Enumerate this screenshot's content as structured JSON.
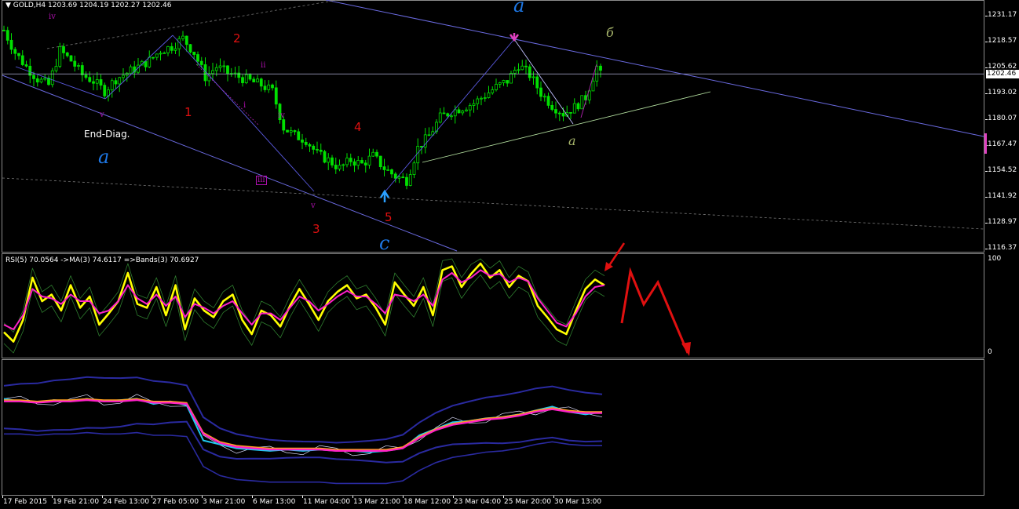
{
  "chart_data": [
    {
      "type": "candlestick",
      "title": "GOLD,H4 1203.69 1204.19 1202.27 1202.46",
      "symbol": "GOLD,H4",
      "ohlc": {
        "open": "1203.69",
        "high": "1204.19",
        "low": "1202.27",
        "close": "1202.46"
      },
      "last_price": "1202.46",
      "ylim": [
        1110,
        1240
      ],
      "yticks": [
        "1231.17",
        "1218.57",
        "1205.62",
        "1193.02",
        "1180.07",
        "1167.47",
        "1154.52",
        "1141.92",
        "1128.97",
        "1116.37"
      ],
      "xticks": [
        "17 Feb 2015",
        "19 Feb 21:00",
        "24 Feb 13:00",
        "27 Feb 05:00",
        "3 Mar 21:00",
        "6 Mar 13:00",
        "11 Mar 04:00",
        "13 Mar 21:00",
        "18 Mar 12:00",
        "23 Mar 04:00",
        "25 Mar 20:00",
        "30 Mar 13:00"
      ],
      "close_path": [
        [
          0,
          1224
        ],
        [
          3,
          1213
        ],
        [
          6,
          1206
        ],
        [
          9,
          1200
        ],
        [
          12,
          1197
        ],
        [
          15,
          1214
        ],
        [
          18,
          1209
        ],
        [
          21,
          1202
        ],
        [
          24,
          1199
        ],
        [
          27,
          1194
        ],
        [
          30,
          1200
        ],
        [
          33,
          1203
        ],
        [
          36,
          1206
        ],
        [
          39,
          1209
        ],
        [
          42,
          1214
        ],
        [
          45,
          1216
        ],
        [
          48,
          1220
        ],
        [
          51,
          1213
        ],
        [
          54,
          1201
        ],
        [
          57,
          1206
        ],
        [
          60,
          1203
        ],
        [
          63,
          1201
        ],
        [
          66,
          1199
        ],
        [
          69,
          1197
        ],
        [
          72,
          1194
        ],
        [
          75,
          1176
        ],
        [
          78,
          1172
        ],
        [
          81,
          1170
        ],
        [
          84,
          1163
        ],
        [
          87,
          1160
        ],
        [
          90,
          1156
        ],
        [
          93,
          1160
        ],
        [
          96,
          1158
        ],
        [
          99,
          1162
        ],
        [
          102,
          1156
        ],
        [
          105,
          1152
        ],
        [
          108,
          1150
        ],
        [
          111,
          1166
        ],
        [
          114,
          1172
        ],
        [
          117,
          1181
        ],
        [
          120,
          1184
        ],
        [
          123,
          1186
        ],
        [
          126,
          1188
        ],
        [
          129,
          1192
        ],
        [
          132,
          1196
        ],
        [
          135,
          1199
        ],
        [
          138,
          1207
        ],
        [
          141,
          1202
        ],
        [
          144,
          1193
        ],
        [
          147,
          1187
        ],
        [
          150,
          1183
        ],
        [
          153,
          1186
        ],
        [
          156,
          1191
        ],
        [
          159,
          1206
        ],
        [
          160,
          1202
        ]
      ],
      "annotations": [
        {
          "text": "iv",
          "style": "mag"
        },
        {
          "text": "v",
          "style": "mag"
        },
        {
          "text": "End-Diag.",
          "style": "white"
        },
        {
          "text": "a",
          "style": "big"
        },
        {
          "text": "2",
          "style": "red"
        },
        {
          "text": "1",
          "style": "red"
        },
        {
          "text": "ii",
          "style": "mag"
        },
        {
          "text": "i",
          "style": "mag"
        },
        {
          "text": "iv",
          "style": "mag"
        },
        {
          "text": "iii",
          "style": "mag"
        },
        {
          "text": "v",
          "style": "mag"
        },
        {
          "text": "3",
          "style": "red"
        },
        {
          "text": "4",
          "style": "red"
        },
        {
          "text": "5",
          "style": "red"
        },
        {
          "text": "c",
          "style": "big"
        },
        {
          "text": "a",
          "style": "big"
        },
        {
          "text": "б",
          "style": "olive"
        },
        {
          "text": "a",
          "style": "olive"
        }
      ]
    },
    {
      "type": "line",
      "title": "RSI(5) 70.0564 ->MA(3) 74.6117 =>Bands(3) 70.6927",
      "ylim": [
        0,
        100
      ],
      "yticks": [
        "100",
        "0"
      ],
      "series": [
        {
          "values": [
            22,
            12,
            35,
            80,
            55,
            62,
            45,
            72,
            48,
            60,
            30,
            42,
            55,
            85,
            52,
            48,
            70,
            40,
            72,
            25,
            58,
            45,
            38,
            55,
            62,
            35,
            20,
            45,
            40,
            28,
            50,
            68,
            52,
            35,
            55,
            65,
            72,
            58,
            62,
            48,
            30,
            75,
            62,
            50,
            70,
            40,
            88,
            92,
            70,
            84,
            95,
            80,
            88,
            70,
            82,
            76,
            50,
            38,
            25,
            20,
            45,
            68,
            78,
            72
          ]
        },
        {
          "values": [
            30,
            25,
            40,
            68,
            60,
            58,
            52,
            62,
            55,
            55,
            42,
            45,
            55,
            72,
            58,
            52,
            62,
            50,
            60,
            38,
            52,
            48,
            42,
            50,
            55,
            42,
            30,
            42,
            42,
            35,
            48,
            60,
            55,
            45,
            52,
            60,
            66,
            60,
            60,
            52,
            42,
            62,
            60,
            55,
            62,
            50,
            78,
            85,
            75,
            80,
            88,
            82,
            84,
            75,
            80,
            76,
            58,
            45,
            32,
            28,
            42,
            60,
            70,
            72
          ]
        }
      ],
      "forecast_arrow": "red"
    },
    {
      "type": "line",
      "series": [
        {
          "values": [
            72,
            70,
            69,
            71,
            70,
            72,
            70,
            71,
            72,
            68,
            70,
            67,
            40,
            37,
            34,
            33,
            32,
            33,
            32,
            33,
            32,
            32,
            31,
            32,
            34,
            44,
            49,
            54,
            55,
            57,
            58,
            60,
            63,
            66,
            62,
            60,
            62
          ]
        },
        {
          "values": [
            70,
            70,
            69,
            70,
            70,
            71,
            70,
            70,
            71,
            69,
            69,
            68,
            45,
            38,
            35,
            34,
            33,
            33,
            33,
            33,
            32,
            32,
            32,
            32,
            34,
            42,
            48,
            52,
            54,
            56,
            57,
            59,
            62,
            64,
            62,
            61,
            61
          ]
        }
      ]
    }
  ]
}
